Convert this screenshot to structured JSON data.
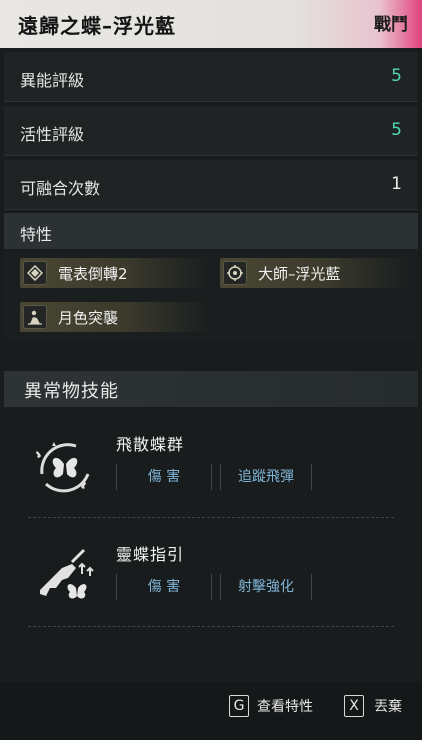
{
  "header": {
    "title": "遠歸之蝶–浮光藍",
    "tag": "戰鬥",
    "tag_color": "#e0427b"
  },
  "stats": [
    {
      "label": "異能評級",
      "value": "5",
      "value_color": "#4fd6b4"
    },
    {
      "label": "活性評級",
      "value": "5",
      "value_color": "#4fd6b4"
    },
    {
      "label": "可融合次數",
      "value": "1",
      "value_color": "#eaeaea"
    }
  ],
  "traits": {
    "heading": "特性",
    "items": [
      {
        "label": "電表倒轉2",
        "icon": "diamond-icon"
      },
      {
        "label": "大師–浮光藍",
        "icon": "target-icon"
      },
      {
        "label": "月色突襲",
        "icon": "figure-icon"
      }
    ]
  },
  "skills": {
    "heading": "異常物技能",
    "items": [
      {
        "name": "飛散蝶群",
        "icon": "butterfly-swarm-icon",
        "tags": [
          "傷 害",
          "追蹤飛彈"
        ]
      },
      {
        "name": "靈蝶指引",
        "icon": "butterfly-gun-icon",
        "tags": [
          "傷 害",
          "射擊強化"
        ]
      }
    ]
  },
  "footer": {
    "actions": [
      {
        "key": "G",
        "label": "查看特性"
      },
      {
        "key": "X",
        "label": "丟棄"
      }
    ]
  }
}
